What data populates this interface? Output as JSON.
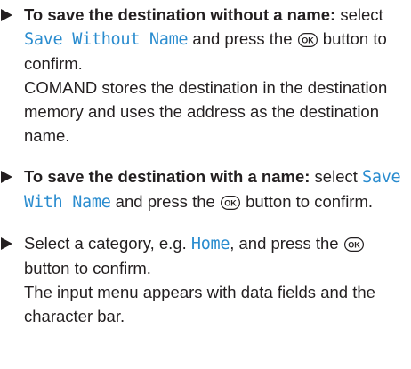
{
  "steps": [
    {
      "bold_lead": "To save the destination without a name:",
      "text_1": " select ",
      "ui_term": "Save Without Name",
      "text_2": " and press the ",
      "button": "OK",
      "text_3": " button to confirm.",
      "result": "COMAND stores the destination in the destination memory and uses the address as the destination name."
    },
    {
      "bold_lead": "To save the destination with a name:",
      "text_1": " select ",
      "ui_term": "Save With Name",
      "text_2": " and press the ",
      "button": "OK",
      "text_3": " button to confirm."
    },
    {
      "text_1": "Select a category, e.g. ",
      "ui_term": "Home",
      "text_2": ", and press the ",
      "button": "OK",
      "text_3": " button to confirm.",
      "result": "The input menu appears with data fields and the character bar."
    }
  ],
  "icons": {
    "bullet": "triangle-right-icon",
    "ok_button": "ok-button-icon"
  }
}
